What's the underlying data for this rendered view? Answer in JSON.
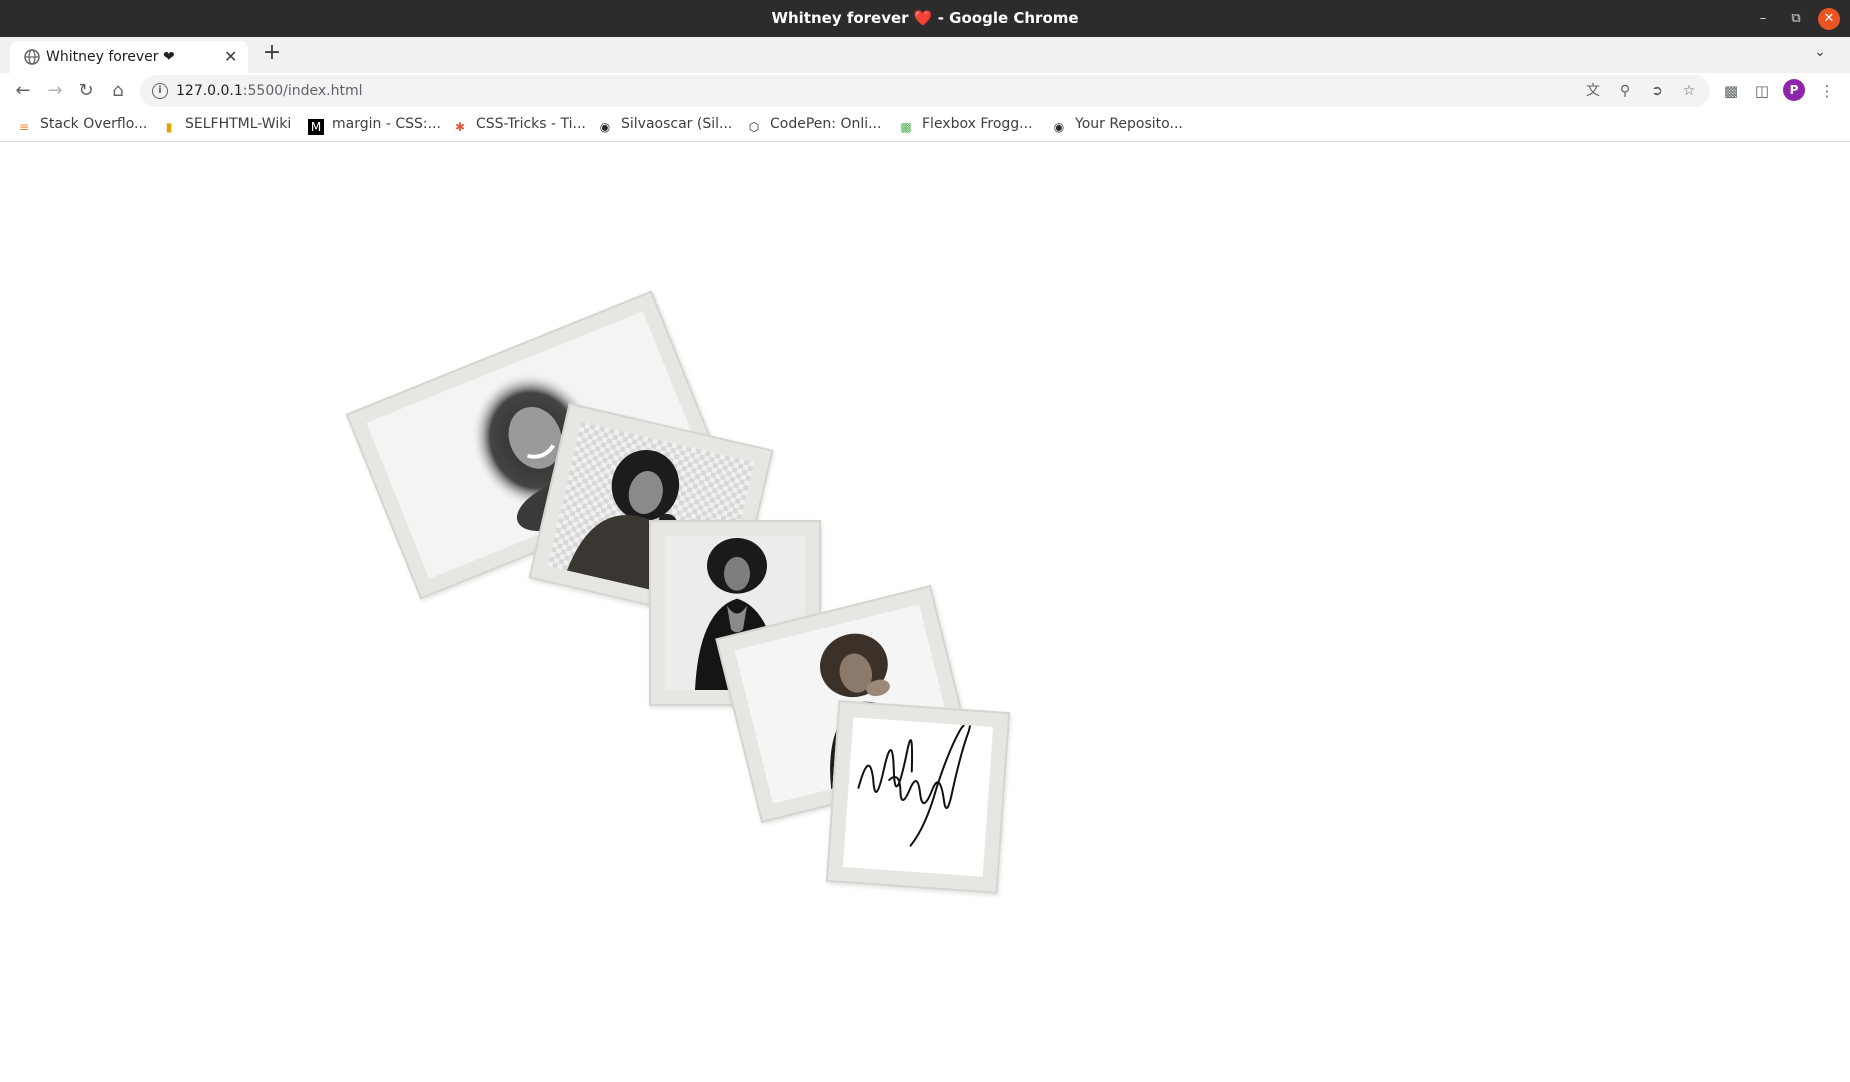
{
  "window": {
    "title": "Whitney forever",
    "title_emoji": "❤️",
    "app_suffix": " - Google Chrome"
  },
  "tab": {
    "label": "Whitney forever ❤"
  },
  "address_bar": {
    "url_host": "127.0.0.1",
    "url_rest": ":5500/index.html"
  },
  "profile": {
    "initial": "P",
    "color": "#8e24aa"
  },
  "bookmarks": [
    {
      "label": "Stack Overflo...",
      "icon": "stackoverflow-icon",
      "color": "#f48024"
    },
    {
      "label": "SELFHTML-Wiki",
      "icon": "selfhtml-icon",
      "color": "#e8a000"
    },
    {
      "label": "margin - CSS:...",
      "icon": "mdn-icon",
      "color": "#000000"
    },
    {
      "label": "CSS-Tricks - Ti...",
      "icon": "csstricks-icon",
      "color": "#e25a3c"
    },
    {
      "label": "Silvaoscar (Sil...",
      "icon": "github-icon",
      "color": "#24292e"
    },
    {
      "label": "CodePen: Onli...",
      "icon": "codepen-icon",
      "color": "#202124"
    },
    {
      "label": "Flexbox Frogg...",
      "icon": "frog-icon",
      "color": "#4caf50"
    },
    {
      "label": "Your Reposito...",
      "icon": "github-icon",
      "color": "#24292e"
    }
  ],
  "gallery": {
    "photos": [
      {
        "name": "photo-portrait-smile",
        "kind": "portrait"
      },
      {
        "name": "photo-curly-hair",
        "kind": "portrait"
      },
      {
        "name": "photo-black-dress",
        "kind": "portrait"
      },
      {
        "name": "photo-hand-on-chin",
        "kind": "portrait"
      },
      {
        "name": "photo-signature",
        "kind": "signature",
        "signature_text": "Whitney"
      }
    ]
  }
}
